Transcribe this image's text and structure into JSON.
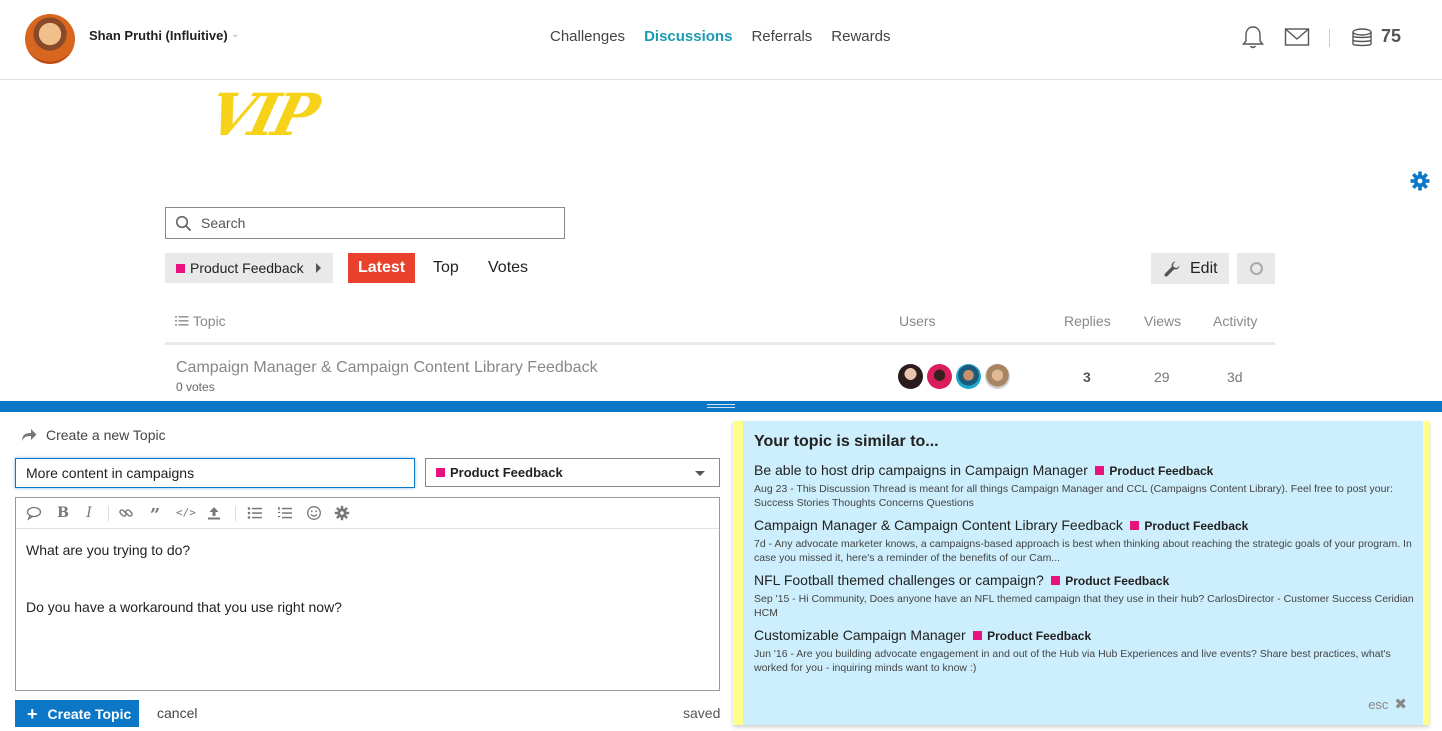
{
  "header": {
    "username": "Shan Pruthi (Influitive)",
    "nav": [
      {
        "label": "Challenges",
        "active": false
      },
      {
        "label": "Discussions",
        "active": true
      },
      {
        "label": "Referrals",
        "active": false
      },
      {
        "label": "Rewards",
        "active": false
      }
    ],
    "points": "75",
    "icons": [
      "bell-icon",
      "mail-icon",
      "coins-icon"
    ]
  },
  "logo": {
    "text": "VIP",
    "color": "#f6d21a"
  },
  "search": {
    "placeholder": "Search"
  },
  "filters": {
    "category": "Product Feedback",
    "category_color": "#e8127c",
    "tabs": [
      "Latest",
      "Top",
      "Votes"
    ],
    "active_tab": "Latest",
    "edit_label": "Edit"
  },
  "table": {
    "headers": {
      "topic": "Topic",
      "users": "Users",
      "replies": "Replies",
      "views": "Views",
      "activity": "Activity"
    },
    "rows": [
      {
        "title": "Campaign Manager & Campaign Content Library Feedback",
        "votes": "0 votes",
        "replies": "3",
        "views": "29",
        "activity": "3d"
      }
    ]
  },
  "composer": {
    "title": "Create a new Topic",
    "topic_title_value": "More content in campaigns",
    "category": "Product Feedback",
    "body_lines": [
      "What are you trying to do?",
      "Do you have a workaround that you use right now?"
    ],
    "create_label": "Create Topic",
    "cancel_label": "cancel",
    "status": "saved"
  },
  "similar": {
    "heading": "Your topic is similar to...",
    "items": [
      {
        "title": "Be able to host drip campaigns in Campaign Manager",
        "category": "Product Feedback",
        "excerpt": "Aug 23 - This Discussion Thread is meant for all things Campaign Manager and CCL (Campaigns Content Library). Feel free to post your: Success Stories Thoughts Concerns Questions"
      },
      {
        "title": "Campaign Manager & Campaign Content Library Feedback",
        "category": "Product Feedback",
        "excerpt": "7d - Any advocate marketer knows, a campaigns-based approach is best when thinking about reaching the strategic goals of your program. In case you missed it, here's a reminder of the benefits of our Cam..."
      },
      {
        "title": "NFL Football themed challenges or campaign?",
        "category": "Product Feedback",
        "excerpt": "Sep '15 - Hi Community, Does anyone have an NFL themed campaign that they use in their hub? CarlosDirector - Customer Success Ceridian HCM"
      },
      {
        "title": "Customizable Campaign Manager",
        "category": "Product Feedback",
        "excerpt": "Jun '16 - Are you building advocate engagement in and out of the Hub via Hub Experiences and live events? Share best practices, what's worked for you - inquiring minds want to know :)"
      }
    ],
    "close_label": "esc"
  },
  "colors": {
    "accent": "#1d9bb2",
    "latest": "#e9412b",
    "primary": "#0d77c7",
    "panel": "#cdeefc",
    "panel_border": "#ffff8c"
  }
}
